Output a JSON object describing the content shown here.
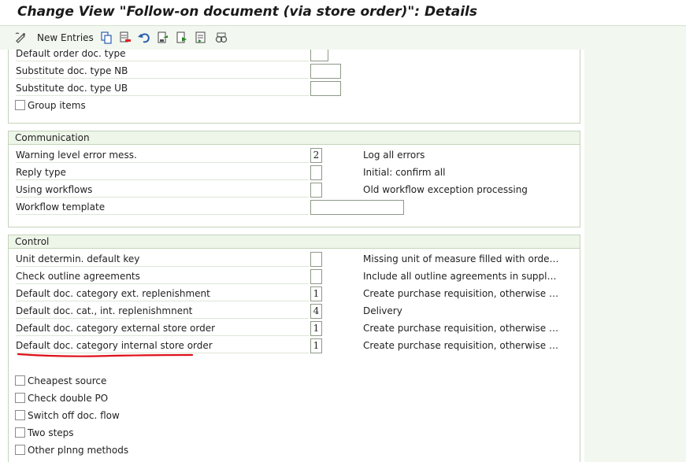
{
  "window": {
    "title": "Change View \"Follow-on document (via store order)\": Details"
  },
  "toolbar": {
    "new_entries_label": "New Entries",
    "icons": [
      "display-change-icon",
      "copy-icon",
      "delete-icon",
      "undo-icon",
      "save-icon",
      "first-entry-icon",
      "next-entry-icon",
      "search-icon"
    ]
  },
  "top_section": {
    "rows": [
      {
        "label": "Default order doc. type",
        "value": ""
      },
      {
        "label": "Substitute doc. type NB",
        "value": ""
      },
      {
        "label": "Substitute doc. type UB",
        "value": ""
      }
    ],
    "group_items_label": "Group items"
  },
  "communication": {
    "title": "Communication",
    "rows": [
      {
        "label": "Warning level error mess.",
        "value": "2",
        "desc": "Log all errors"
      },
      {
        "label": "Reply type",
        "value": "",
        "desc": "Initial: confirm all"
      },
      {
        "label": "Using workflows",
        "value": "",
        "desc": "Old workflow exception processing"
      },
      {
        "label": "Workflow template",
        "value": "",
        "desc": ""
      }
    ]
  },
  "control": {
    "title": "Control",
    "rows": [
      {
        "label": "Unit determin. default key",
        "value": "",
        "desc": "Missing unit of measure filled with order unit"
      },
      {
        "label": "Check outline agreements",
        "value": "",
        "desc": "Include all outline agreements in supply so..."
      },
      {
        "label": "Default doc. category ext. replenishment",
        "value": "1",
        "desc": "Create purchase requisition, otherwise err..."
      },
      {
        "label": "Default doc. cat., int. replenishmnent",
        "value": "4",
        "desc": "Delivery"
      },
      {
        "label": "Default doc. category external store order",
        "value": "1",
        "desc": "Create purchase requisition, otherwise err..."
      },
      {
        "label": "Default doc. category internal store order",
        "value": "1",
        "desc": "Create purchase requisition, otherwise err..."
      }
    ],
    "checkboxes": [
      {
        "label": "Cheapest source"
      },
      {
        "label": "Check double PO"
      },
      {
        "label": "Switch off doc. flow"
      },
      {
        "label": "Two steps"
      },
      {
        "label": "Other plnng methods"
      }
    ]
  },
  "colors": {
    "annotation": "#e0101a",
    "group_border": "#c3d4b9",
    "background": "#f2f7ef"
  }
}
